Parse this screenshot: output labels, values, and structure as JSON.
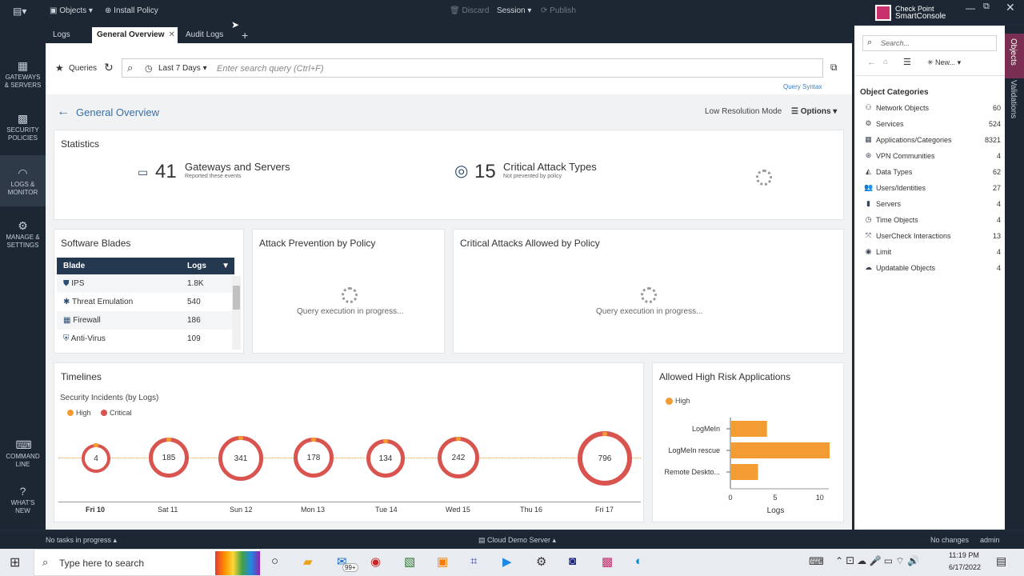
{
  "toolbar": {
    "objects_label": "Objects",
    "install_policy_label": "Install Policy",
    "discard_label": "Discard",
    "session_label": "Session",
    "publish_label": "Publish",
    "brand_line1": "Check Point",
    "brand_line2": "SmartConsole"
  },
  "tabs": [
    {
      "label": "Logs"
    },
    {
      "label": "General Overview"
    },
    {
      "label": "Audit Logs"
    }
  ],
  "leftnav": [
    {
      "label1": "GATEWAYS",
      "label2": "& SERVERS"
    },
    {
      "label1": "SECURITY",
      "label2": "POLICIES"
    },
    {
      "label1": "LOGS &",
      "label2": "MONITOR"
    },
    {
      "label1": "MANAGE &",
      "label2": "SETTINGS"
    },
    {
      "label1": "COMMAND",
      "label2": "LINE"
    },
    {
      "label1": "WHAT'S",
      "label2": "NEW"
    }
  ],
  "query": {
    "queries_label": "Queries",
    "time_range": "Last 7 Days",
    "placeholder": "Enter search query (Ctrl+F)",
    "syntax_link": "Query Syntax"
  },
  "overview": {
    "title": "General Overview",
    "low_res_label": "Low Resolution Mode",
    "options_label": "Options"
  },
  "statistics": {
    "title": "Statistics",
    "gateways_count": "41",
    "gateways_label": "Gateways and Servers",
    "gateways_sub": "Reported these events",
    "attack_count": "15",
    "attack_label": "Critical Attack Types",
    "attack_sub": "Not prevented by policy"
  },
  "blades": {
    "title": "Software Blades",
    "col_blade": "Blade",
    "col_logs": "Logs",
    "rows": [
      {
        "name": "IPS",
        "logs": "1.8K"
      },
      {
        "name": "Threat Emulation",
        "logs": "540"
      },
      {
        "name": "Firewall",
        "logs": "186"
      },
      {
        "name": "Anti-Virus",
        "logs": "109"
      }
    ]
  },
  "attack_prevention": {
    "title": "Attack Prevention by Policy",
    "status": "Query execution in progress..."
  },
  "critical_allowed": {
    "title": "Critical Attacks Allowed by Policy",
    "status": "Query execution in progress..."
  },
  "timelines": {
    "title": "Timelines",
    "subtitle": "Security Incidents (by Logs)",
    "legend_high": "High",
    "legend_critical": "Critical",
    "days": [
      "Fri 10",
      "Sat 11",
      "Sun 12",
      "Mon 13",
      "Tue 14",
      "Wed 15",
      "Thu 16",
      "Fri 17"
    ],
    "counts": [
      "4",
      "185",
      "341",
      "178",
      "134",
      "242",
      "",
      "796"
    ]
  },
  "high_risk": {
    "title": "Allowed High Risk Applications",
    "legend": "High",
    "xlabel": "Logs",
    "ticks": [
      "0",
      "5",
      "10"
    ]
  },
  "chart_data": {
    "type": "bar",
    "title": "Allowed High Risk Applications",
    "categories": [
      "LogMeIn",
      "LogMeIn rescue",
      "Remote Deskto..."
    ],
    "series": [
      {
        "name": "High",
        "values": [
          4,
          11,
          3
        ]
      }
    ],
    "xlabel": "Logs",
    "xlim": [
      0,
      11
    ],
    "orientation": "horizontal"
  },
  "objects_panel": {
    "search_placeholder": "Search...",
    "new_label": "New...",
    "categories_title": "Object Categories",
    "side_tab1": "Objects",
    "side_tab2": "Validations",
    "categories": [
      {
        "label": "Network Objects",
        "count": "60"
      },
      {
        "label": "Services",
        "count": "524"
      },
      {
        "label": "Applications/Categories",
        "count": "8321"
      },
      {
        "label": "VPN Communities",
        "count": "4"
      },
      {
        "label": "Data Types",
        "count": "62"
      },
      {
        "label": "Users/Identities",
        "count": "27"
      },
      {
        "label": "Servers",
        "count": "4"
      },
      {
        "label": "Time Objects",
        "count": "4"
      },
      {
        "label": "UserCheck Interactions",
        "count": "13"
      },
      {
        "label": "Limit",
        "count": "4"
      },
      {
        "label": "Updatable Objects",
        "count": "4"
      }
    ]
  },
  "statusbar": {
    "tasks": "No tasks in progress",
    "server": "Cloud Demo Server",
    "changes": "No changes",
    "user": "admin"
  },
  "taskbar": {
    "search_placeholder": "Type here to search",
    "badge": "99+",
    "time": "11:19 PM",
    "date": "6/17/2022"
  }
}
